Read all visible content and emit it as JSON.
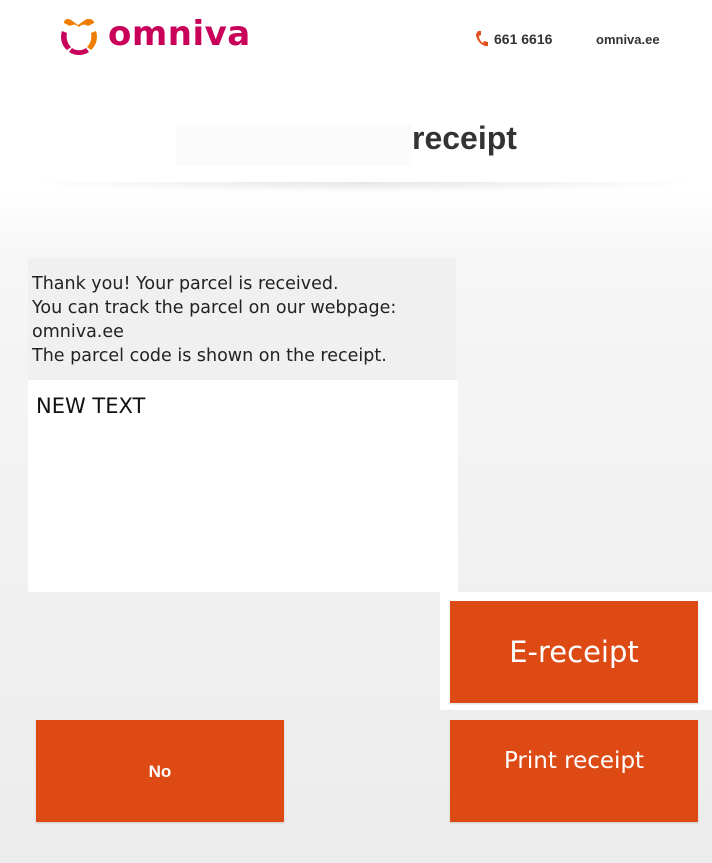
{
  "colors": {
    "accent": "#dd4a14",
    "logo_orange": "#f07d00",
    "logo_magenta": "#c8005a",
    "text_dark": "#333333"
  },
  "header": {
    "logo": {
      "text": "omniva",
      "icon": "omniva-logo-icon"
    },
    "phone": {
      "icon": "phone-icon",
      "number": "661 6616"
    },
    "website": "omniva.ee"
  },
  "page": {
    "title": "receipt"
  },
  "message": {
    "lines": [
      "Thank you! Your parcel is received.",
      "You can track the parcel on our webpage:",
      "omniva.ee",
      "The parcel code is shown on the receipt."
    ]
  },
  "text_area": {
    "value": "NEW TEXT"
  },
  "buttons": {
    "e_receipt": "E-receipt",
    "no": "No",
    "print_receipt": "Print receipt"
  }
}
